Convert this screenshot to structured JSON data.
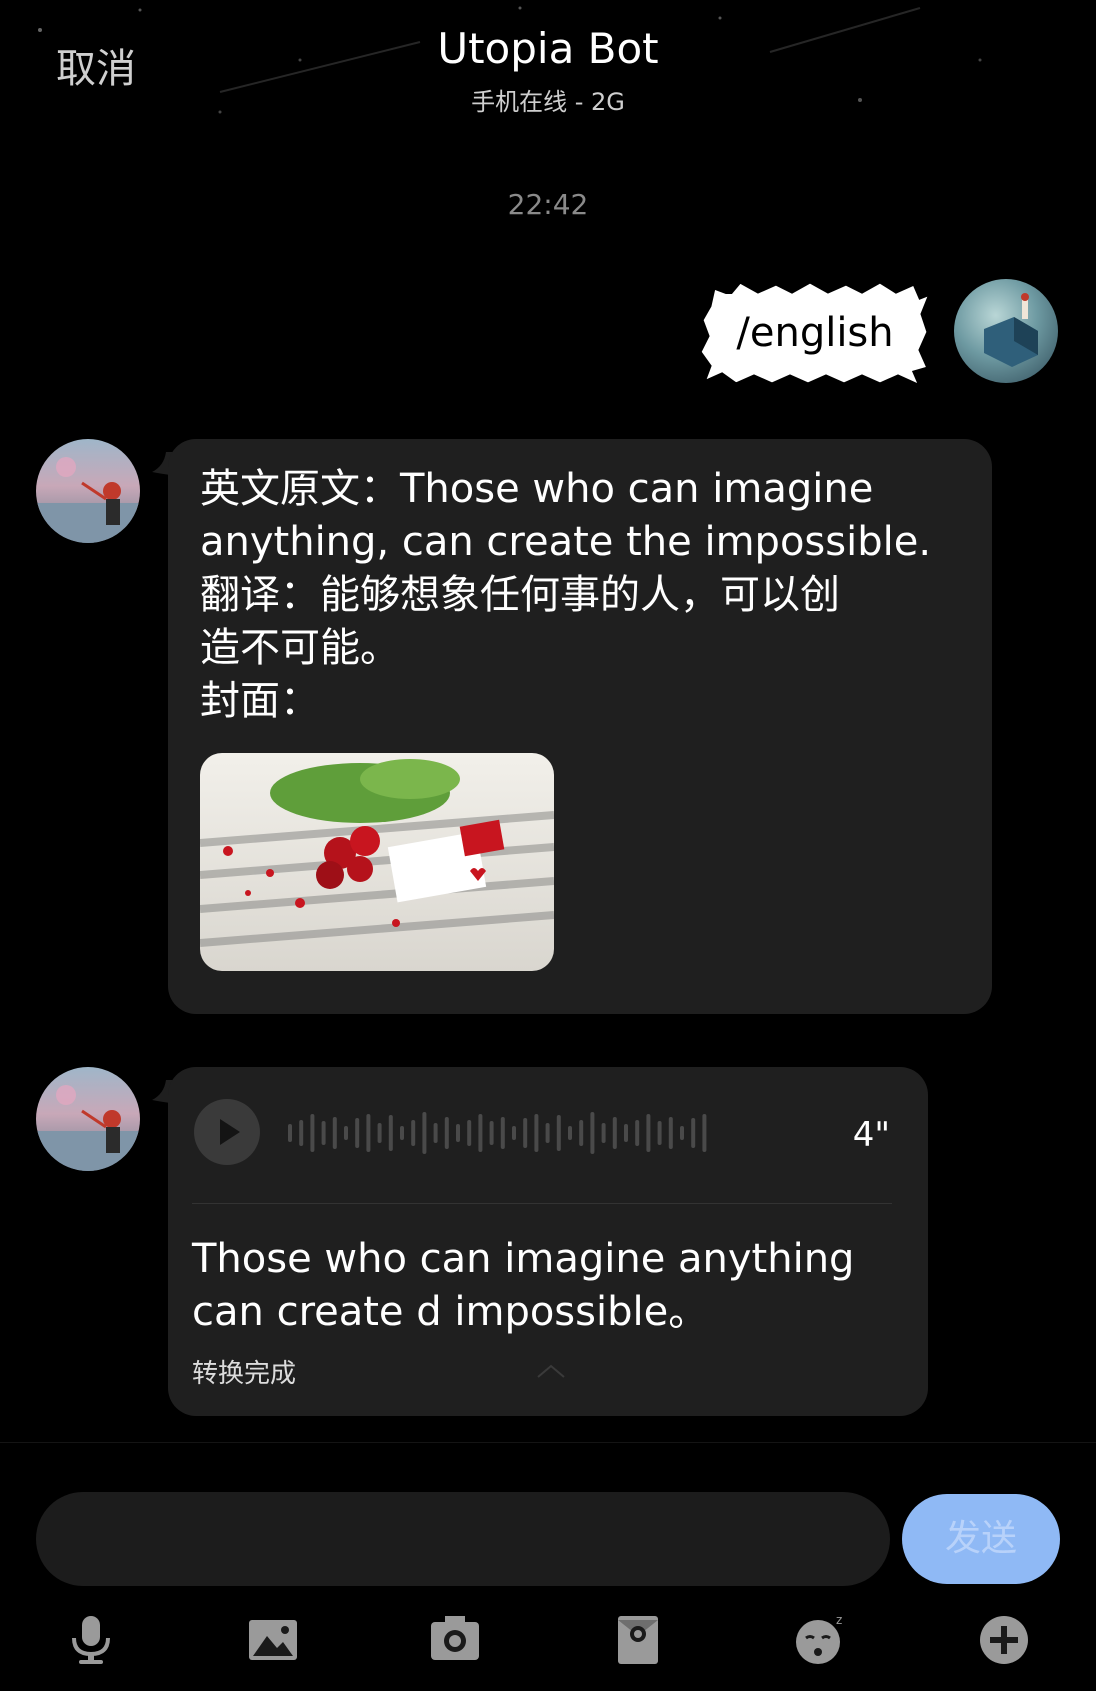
{
  "header": {
    "cancel_label": "取消",
    "title": "Utopia Bot",
    "subtitle": "手机在线 - 2G"
  },
  "timestamp": "22:42",
  "messages": [
    {
      "sender": "user",
      "type": "sticker",
      "text": "/english"
    },
    {
      "sender": "bot",
      "type": "text_with_image",
      "lines": [
        "英文原文：Those who can imagine",
        "anything, can create the impossible.",
        "翻译：能够想象任何事的人，可以创",
        "造不可能。",
        "封面："
      ]
    },
    {
      "sender": "bot",
      "type": "voice",
      "duration": "4\"",
      "transcript_lines": [
        "Those who can imagine anything",
        "can create d impossible。"
      ],
      "status": "转换完成"
    }
  ],
  "input": {
    "value": "",
    "placeholder": ""
  },
  "send_label": "发送",
  "toolbar": {
    "icons": [
      "microphone-icon",
      "image-icon",
      "camera-icon",
      "red-packet-icon",
      "emoji-icon",
      "plus-icon"
    ]
  },
  "colors": {
    "background": "#000000",
    "bubble": "#1f1f1f",
    "send_button": "#8fb9f5",
    "timestamp": "#8a8a8a"
  }
}
